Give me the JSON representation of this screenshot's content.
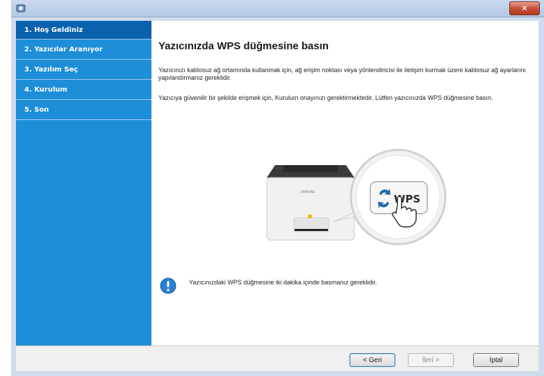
{
  "window": {
    "title": ""
  },
  "sidebar": {
    "items": [
      {
        "label": "1. Hoş Geldiniz"
      },
      {
        "label": "2. Yazıcılar Aranıyor"
      },
      {
        "label": "3. Yazılım Seç"
      },
      {
        "label": "4. Kurulum"
      },
      {
        "label": "5. Son"
      }
    ],
    "active_index": 0
  },
  "main": {
    "title": "Yazıcınızda WPS düğmesine basın",
    "paragraph1": "Yazıcınızı kablosuz ağ ortamında kullanmak için, ağ erişim noktası veya yönlendiricisi ile iletişim kurmak üzere kablosuz ağ ayarlarını yapılandırmanız gereklidir.",
    "paragraph2": "Yazıcıya güvenilir bir şekilde erişmek için, Kurulum onayınızı gerektirmektedir. Lütfen yazıcınızda WPS düğmesine basın.",
    "wps_label": "WPS",
    "printer_brand": "SAMSUNG",
    "info_text": "Yazıcınızdaki WPS düğmesine iki dakika içinde basmanız gereklidir."
  },
  "footer": {
    "back_label": "< Geri",
    "next_label": "İleri >",
    "cancel_label": "İptal"
  },
  "colors": {
    "sidebar": "#1d8ed7",
    "sidebar_active": "#0b61ad",
    "wps_blue": "#2567b0",
    "info_blue": "#2a7fd4"
  },
  "icons": [
    "app-icon",
    "close-icon",
    "printer-illustration",
    "wps-refresh-icon",
    "hand-cursor-icon",
    "info-icon"
  ]
}
